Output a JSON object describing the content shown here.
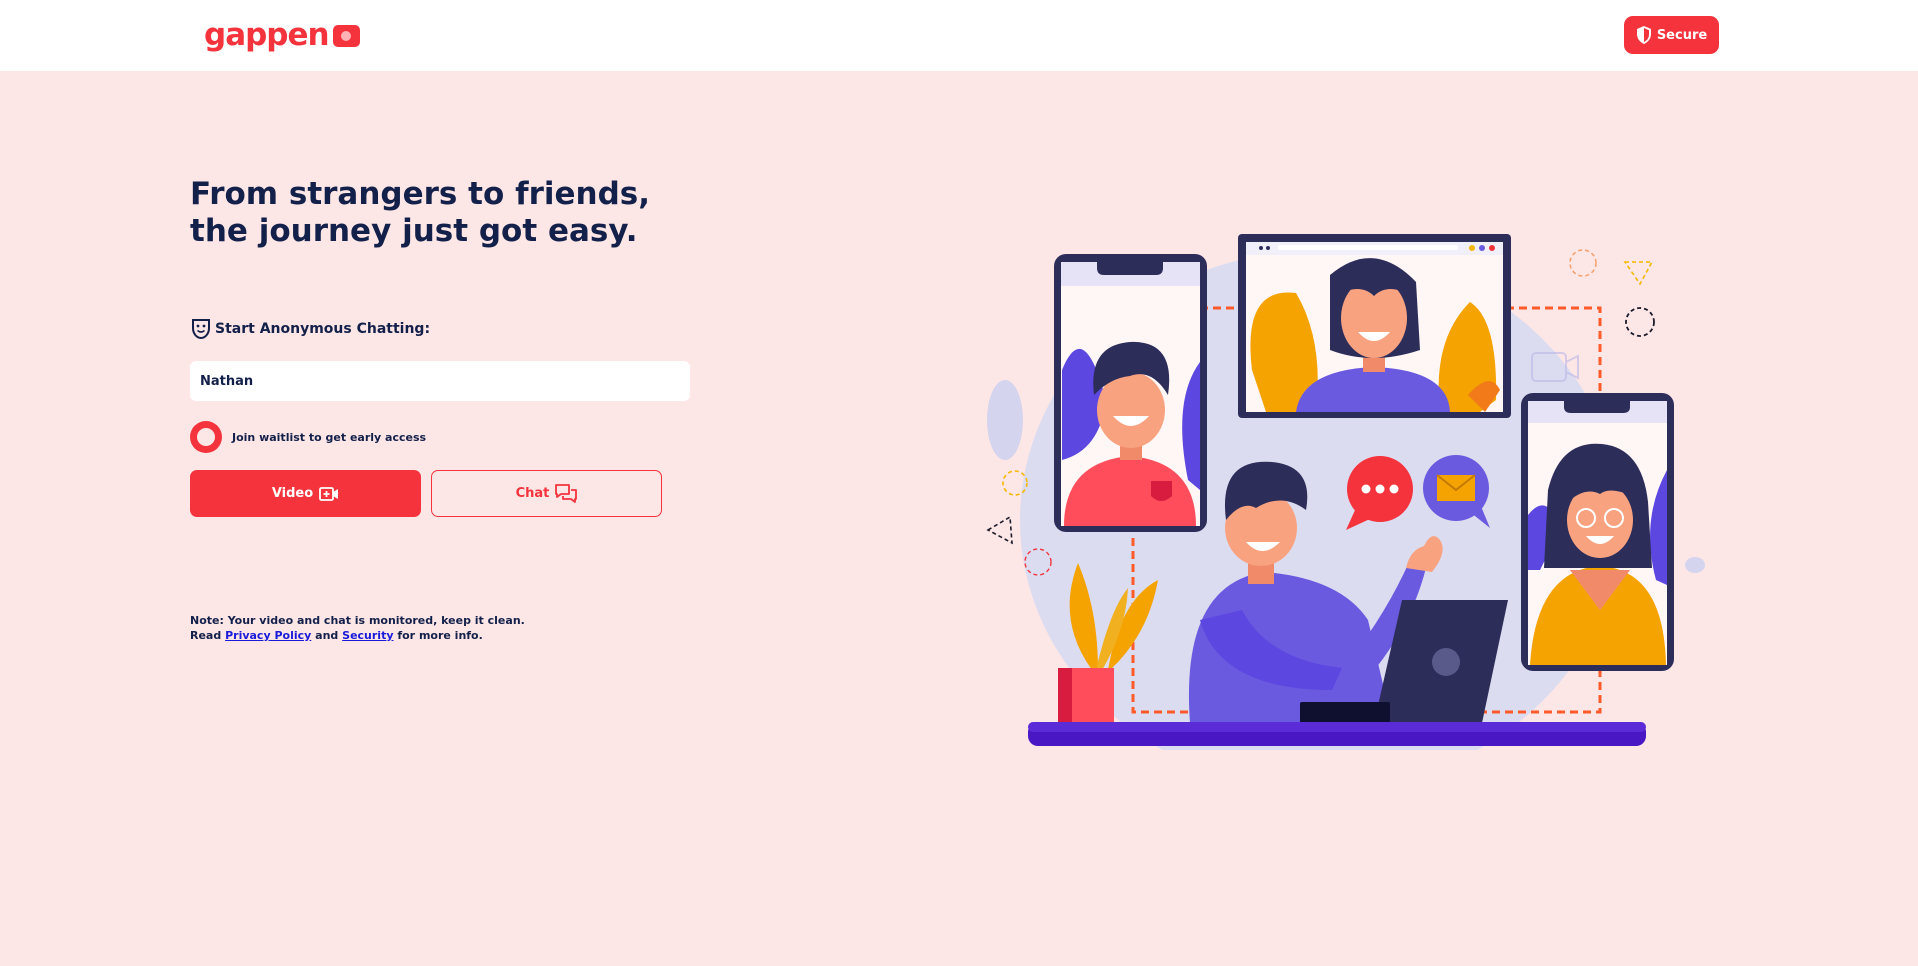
{
  "brand": {
    "logo_text": "gappen",
    "logo_icon": "camera-icon",
    "accent": "#f4333c",
    "navy": "#13204a",
    "background": "#fde6e6"
  },
  "header": {
    "secure_label": "Secure",
    "secure_icon": "shield-icon"
  },
  "hero": {
    "line1": "From strangers to friends,",
    "line2": "the journey just got easy."
  },
  "form": {
    "section_label": "Start Anonymous Chatting:",
    "section_icon": "mask-icon",
    "name_value": "Nathan",
    "waitlist_label": "Join waitlist to get early access",
    "video_label": "Video",
    "chat_label": "Chat"
  },
  "note": {
    "line1": "Note: Your video and chat is monitored, keep it clean.",
    "read": "Read",
    "privacy_link": "Privacy Policy",
    "and": "and",
    "security_link": "Security",
    "suffix": "for more info."
  }
}
